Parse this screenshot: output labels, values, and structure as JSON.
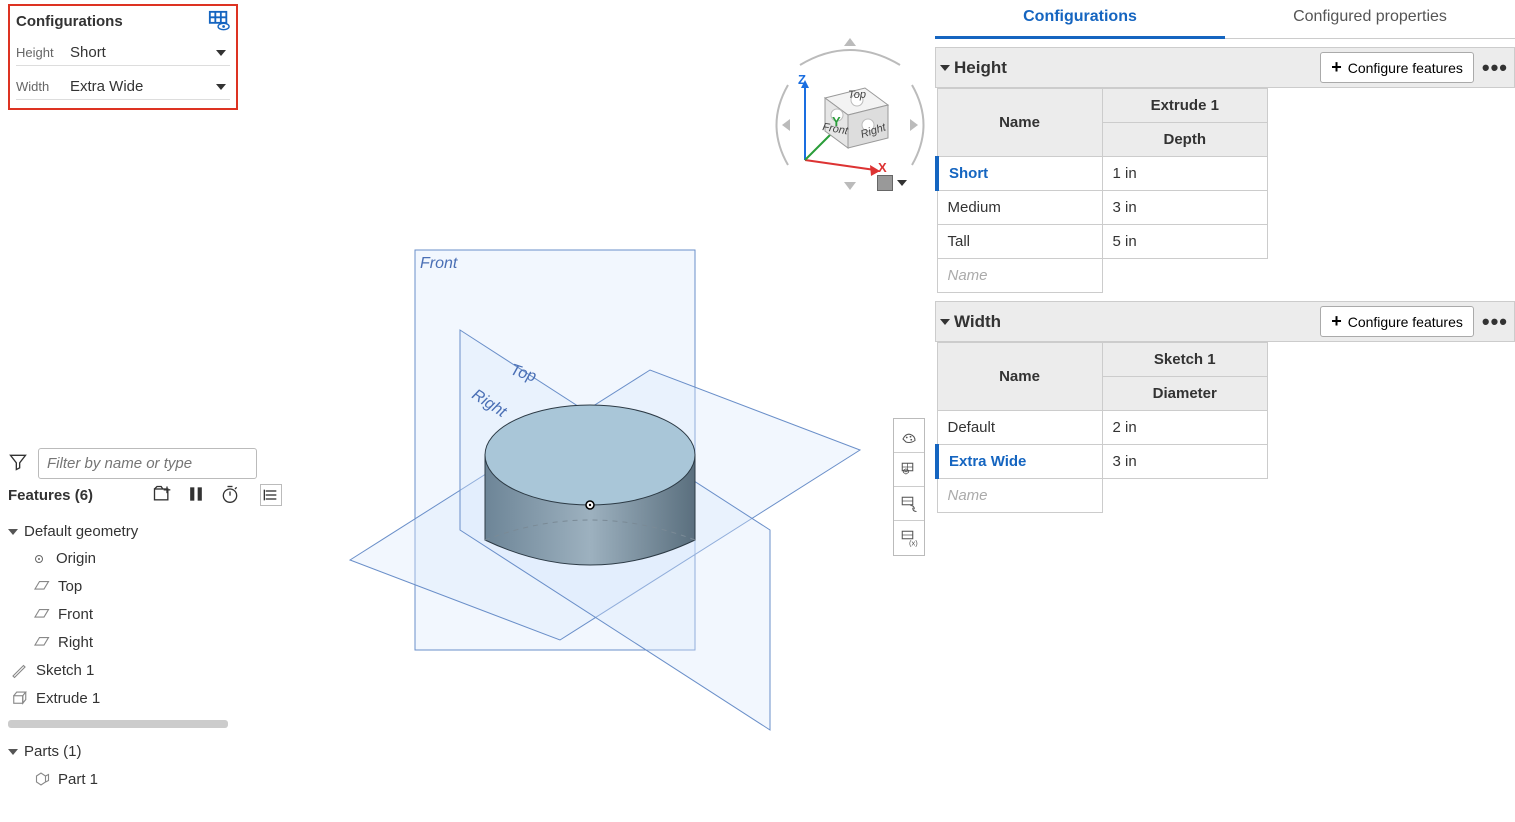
{
  "configPanel": {
    "title": "Configurations",
    "rows": [
      {
        "label": "Height",
        "value": "Short"
      },
      {
        "label": "Width",
        "value": "Extra Wide"
      }
    ]
  },
  "filter": {
    "placeholder": "Filter by name or type"
  },
  "features": {
    "title": "Features (6)",
    "groups": [
      {
        "label": "Default geometry",
        "children": [
          {
            "label": "Origin",
            "icon": "origin"
          },
          {
            "label": "Top",
            "icon": "plane"
          },
          {
            "label": "Front",
            "icon": "plane"
          },
          {
            "label": "Right",
            "icon": "plane"
          }
        ]
      },
      {
        "label": "Sketch 1",
        "icon": "sketch",
        "flat": true
      },
      {
        "label": "Extrude 1",
        "icon": "extrude",
        "flat": true
      }
    ],
    "parts": {
      "title": "Parts (1)",
      "items": [
        {
          "label": "Part 1"
        }
      ]
    }
  },
  "viewport": {
    "planeLabels": {
      "front": "Front",
      "top": "Top",
      "right": "Right"
    },
    "axes": {
      "x": "X",
      "y": "Y",
      "z": "Z"
    },
    "cubeFaces": {
      "top": "Top",
      "front": "Front",
      "right": "Right"
    }
  },
  "rightPanel": {
    "tabs": [
      {
        "label": "Configurations",
        "active": true
      },
      {
        "label": "Configured properties",
        "active": false
      }
    ],
    "configureFeaturesLabel": "Configure features",
    "sections": [
      {
        "title": "Height",
        "featureCol": "Extrude 1",
        "paramCol": "Depth",
        "nameHeader": "Name",
        "rows": [
          {
            "name": "Short",
            "value": "1 in",
            "active": true
          },
          {
            "name": "Medium",
            "value": "3 in",
            "active": false
          },
          {
            "name": "Tall",
            "value": "5 in",
            "active": false
          }
        ],
        "newRowPlaceholder": "Name"
      },
      {
        "title": "Width",
        "featureCol": "Sketch 1",
        "paramCol": "Diameter",
        "nameHeader": "Name",
        "rows": [
          {
            "name": "Default",
            "value": "2 in",
            "active": false
          },
          {
            "name": "Extra Wide",
            "value": "3 in",
            "active": true
          }
        ],
        "newRowPlaceholder": "Name"
      }
    ]
  }
}
